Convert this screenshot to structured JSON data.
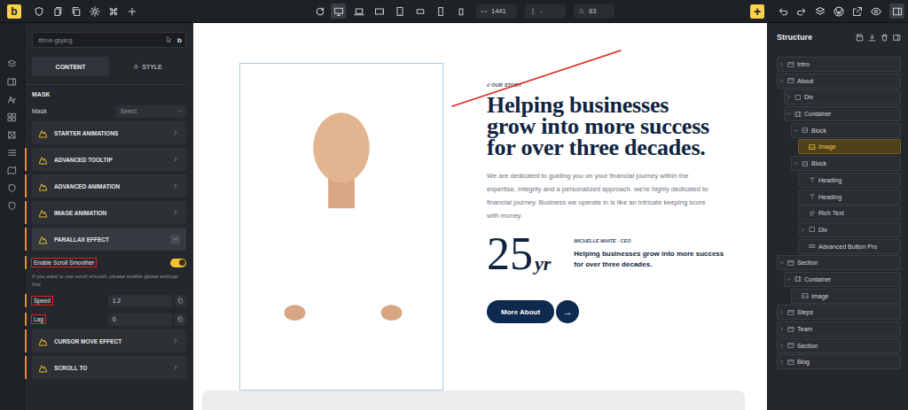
{
  "toolbar": {
    "logo": "b",
    "width": "1441",
    "height": "-",
    "zoom": "83",
    "add": "+",
    "structure_panel_open": true,
    "devices": [
      {
        "selected": true
      },
      {
        "selected": false
      },
      {
        "selected": false
      },
      {
        "selected": false
      },
      {
        "selected": false
      },
      {
        "selected": false
      },
      {
        "selected": false
      }
    ]
  },
  "element": {
    "id": "#brxe-gsykcg",
    "badge": "b"
  },
  "tabs": [
    {
      "label": "CONTENT",
      "selected": true
    },
    {
      "label": "STYLE",
      "selected": false
    }
  ],
  "mask": {
    "section": "MASK",
    "label": "Mask",
    "placeholder": "Select"
  },
  "accordions": [
    {
      "label": "STARTER ANIMATIONS",
      "expanded": false,
      "modified": false
    },
    {
      "label": "ADVANCED TOOLTIP",
      "expanded": false,
      "modified": true
    },
    {
      "label": "ADVANCED ANIMATION",
      "expanded": false,
      "modified": true
    },
    {
      "label": "IMAGE ANIMATION",
      "expanded": false,
      "modified": true
    },
    {
      "label": "PARALLAX EFFECT",
      "expanded": true,
      "modified": true
    },
    {
      "label": "CURSOR MOVE EFFECT",
      "expanded": false,
      "modified": true
    },
    {
      "label": "SCROLL TO",
      "expanded": false,
      "modified": true
    }
  ],
  "parallax": {
    "toggle": {
      "label": "Enable Scroll Smoother",
      "on": true,
      "highlighted": true,
      "modified": true
    },
    "note": "If you want to use scroll smooth, please enable global settings first",
    "fields": [
      {
        "label": "Speed",
        "value": "1.2",
        "highlighted": true,
        "modified": true
      },
      {
        "label": "Lag",
        "value": "0",
        "highlighted": true,
        "modified": true
      }
    ]
  },
  "canvas": {
    "eyebrow": "// OUR STORY",
    "heading": "Helping businesses grow into more success for over three decades.",
    "paragraph": "We are dedicated to guiding you on your financial journey within the expertise, integrity and a personalized approach. we're highly dedicated to financial journey. Business we operate in is like an intricate keeping score with money.",
    "stat_number": "25",
    "stat_unit": "yr",
    "author": "MICHELLE WHITE - CEO",
    "quote": "Helping businesses grow into more success for over three decades.",
    "button": "More About",
    "button_icon": "→"
  },
  "structure": {
    "title": "Structure",
    "items": [
      {
        "label": "Intro",
        "kind": "section",
        "depth": 0,
        "has_children": true,
        "expanded": false,
        "selected": false
      },
      {
        "label": "About",
        "kind": "section",
        "depth": 0,
        "has_children": true,
        "expanded": true,
        "selected": false
      },
      {
        "label": "Div",
        "kind": "div",
        "depth": 1,
        "has_children": true,
        "expanded": false,
        "selected": false
      },
      {
        "label": "Container",
        "kind": "container",
        "depth": 1,
        "has_children": true,
        "expanded": true,
        "selected": false
      },
      {
        "label": "Block",
        "kind": "block",
        "depth": 2,
        "has_children": true,
        "expanded": true,
        "selected": false
      },
      {
        "label": "Image",
        "kind": "image",
        "depth": 3,
        "has_children": false,
        "expanded": false,
        "selected": true
      },
      {
        "label": "Block",
        "kind": "block",
        "depth": 2,
        "has_children": true,
        "expanded": true,
        "selected": false
      },
      {
        "label": "Heading",
        "kind": "heading",
        "depth": 3,
        "has_children": false,
        "expanded": false,
        "selected": false
      },
      {
        "label": "Heading",
        "kind": "heading",
        "depth": 3,
        "has_children": false,
        "expanded": false,
        "selected": false
      },
      {
        "label": "Rich Text",
        "kind": "text",
        "depth": 3,
        "has_children": false,
        "expanded": false,
        "selected": false
      },
      {
        "label": "Div",
        "kind": "div",
        "depth": 3,
        "has_children": true,
        "expanded": false,
        "selected": false
      },
      {
        "label": "Advanced Button Pro",
        "kind": "button",
        "depth": 3,
        "has_children": false,
        "expanded": false,
        "selected": false
      },
      {
        "label": "Section",
        "kind": "section",
        "depth": 0,
        "has_children": true,
        "expanded": true,
        "selected": false
      },
      {
        "label": "Container",
        "kind": "container",
        "depth": 1,
        "has_children": true,
        "expanded": true,
        "selected": false
      },
      {
        "label": "Image",
        "kind": "image",
        "depth": 2,
        "has_children": false,
        "expanded": false,
        "selected": false
      },
      {
        "label": "Steps",
        "kind": "section",
        "depth": 0,
        "has_children": true,
        "expanded": false,
        "selected": false
      },
      {
        "label": "Team",
        "kind": "section",
        "depth": 0,
        "has_children": true,
        "expanded": false,
        "selected": false
      },
      {
        "label": "Section",
        "kind": "section",
        "depth": 0,
        "has_children": true,
        "expanded": false,
        "selected": false
      },
      {
        "label": "Blog",
        "kind": "section",
        "depth": 0,
        "has_children": true,
        "expanded": false,
        "selected": false
      }
    ]
  }
}
